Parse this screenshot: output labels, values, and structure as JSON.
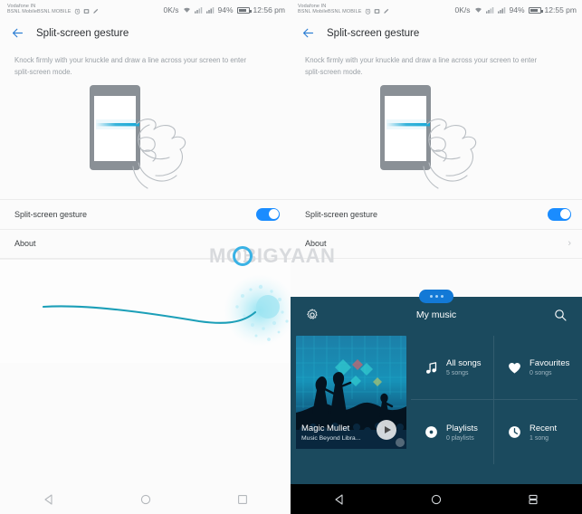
{
  "left": {
    "status_bar": {
      "carrier_line1": "Vodafone IN",
      "carrier_line2": "BSNL MobileBSNL MOBILE",
      "data_rate": "0K/s",
      "battery": "94%",
      "time": "12:56 pm",
      "icons": [
        "alarm-icon",
        "sim-icon",
        "edit-icon",
        "wifi-icon",
        "signal-icon-1",
        "signal-icon-2",
        "battery-icon"
      ]
    },
    "app_bar": {
      "back_icon": "back-arrow-icon",
      "title": "Split-screen gesture"
    },
    "description": "Knock firmly with your knuckle and draw a line across your screen to enter split-screen mode.",
    "illustration": {
      "name": "knuckle-gesture-illustration",
      "phone_color": "#8a9096",
      "line_color": "#19a9d6"
    },
    "rows": [
      {
        "label": "Split-screen gesture",
        "control": "toggle",
        "state": "on"
      },
      {
        "label": "About",
        "control": "chevron",
        "state": ""
      }
    ],
    "stroke": {
      "name": "knuckle-swipe-stroke",
      "color": "#1c9fb8"
    },
    "watermark": "MOBIGYAAN",
    "nav": [
      {
        "name": "nav-back-button",
        "icon": "back-triangle-icon"
      },
      {
        "name": "nav-home-button",
        "icon": "home-circle-icon"
      },
      {
        "name": "nav-recents-button",
        "icon": "recents-square-icon"
      }
    ]
  },
  "right": {
    "status_bar": {
      "carrier_line1": "Vodafone IN",
      "carrier_line2": "BSNL MobileBSNL MOBILE",
      "data_rate": "0K/s",
      "battery": "94%",
      "time": "12:55 pm"
    },
    "app_bar": {
      "back_icon": "back-arrow-icon",
      "title": "Split-screen gesture"
    },
    "description": "Knock firmly with your knuckle and draw a line across your screen to enter split-screen mode.",
    "rows": [
      {
        "label": "Split-screen gesture",
        "control": "toggle",
        "state": "on"
      },
      {
        "label": "About",
        "control": "chevron",
        "state": ""
      }
    ],
    "watermark": "MOBIGYAAN",
    "music": {
      "handle": "drag-handle",
      "settings_icon": "gear-icon",
      "title": "My music",
      "search_icon": "search-icon",
      "album": {
        "title": "Magic Mullet",
        "subtitle": "Music Beyond Libra...",
        "play_icon": "play-icon"
      },
      "tiles": [
        {
          "icon": "music-note-icon",
          "title": "All songs",
          "subtitle": "5 songs"
        },
        {
          "icon": "heart-icon",
          "title": "Favourites",
          "subtitle": "0 songs"
        },
        {
          "icon": "disc-icon",
          "title": "Playlists",
          "subtitle": "0 playlists"
        },
        {
          "icon": "clock-icon",
          "title": "Recent",
          "subtitle": "1 song"
        }
      ],
      "background_color": "#1b4a5e"
    },
    "nav": [
      {
        "name": "nav-back-button",
        "icon": "back-triangle-icon"
      },
      {
        "name": "nav-home-button",
        "icon": "home-circle-icon"
      },
      {
        "name": "nav-splitscreen-button",
        "icon": "split-screen-icon"
      }
    ]
  }
}
